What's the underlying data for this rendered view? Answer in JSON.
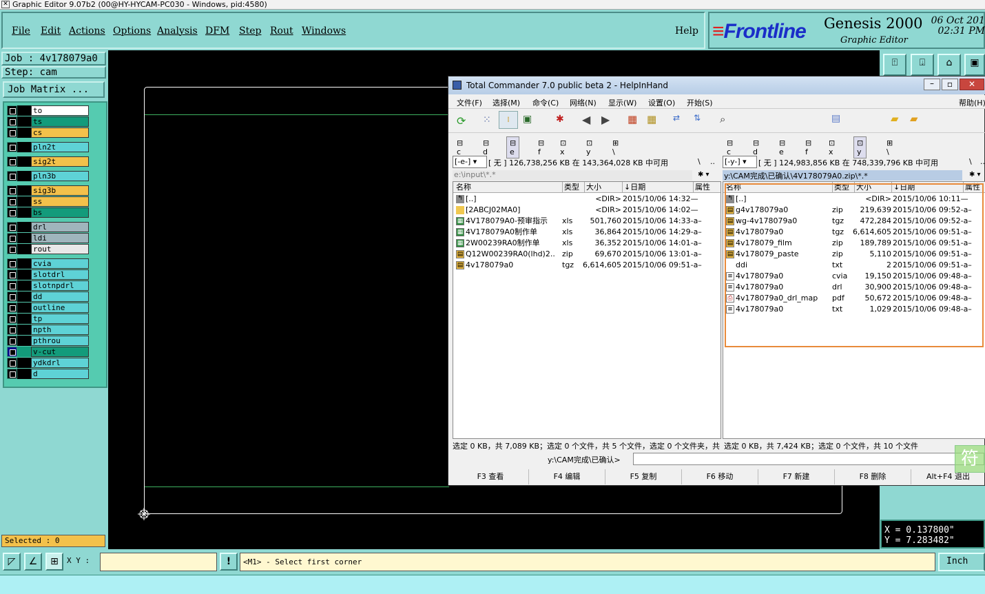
{
  "window": {
    "title": "Graphic Editor 9.07b2 (00@HY-HYCAM-PC030 - Windows, pid:4580)"
  },
  "menu": [
    "File",
    "Edit",
    "Actions",
    "Options",
    "Analysis",
    "DFM",
    "Step",
    "Rout",
    "Windows"
  ],
  "help_label": "Help",
  "brand": {
    "logo": "Frontline",
    "product": "Genesis 2000",
    "subtitle": "Graphic Editor",
    "date_line1": "06 Oct 201",
    "date_line2": "02:31 PM"
  },
  "job": {
    "job_label": "Job : 4v178079a0",
    "step_label": "Step: cam",
    "matrix_button": "Job Matrix ..."
  },
  "layers": [
    {
      "name": "to",
      "color": "#ffffff"
    },
    {
      "name": "ts",
      "color": "#139b7b"
    },
    {
      "name": "cs",
      "color": "#f3c14b"
    },
    {
      "name": "pln2t",
      "color": "#5ed2d6"
    },
    {
      "name": "sig2t",
      "color": "#f3c14b"
    },
    {
      "name": "pln3b",
      "color": "#5ed2d6"
    },
    {
      "name": "sig3b",
      "color": "#f3c14b"
    },
    {
      "name": "ss",
      "color": "#f3c14b"
    },
    {
      "name": "bs",
      "color": "#139b7b"
    },
    {
      "name": "drl",
      "color": "#9fb5bc"
    },
    {
      "name": "ldi",
      "color": "#9fb5bc"
    },
    {
      "name": "rout",
      "color": "#e8e8e8"
    },
    {
      "name": "cvia",
      "color": "#5ed2d6"
    },
    {
      "name": "slotdrl",
      "color": "#5ed2d6"
    },
    {
      "name": "slotnpdrl",
      "color": "#5ed2d6"
    },
    {
      "name": "dd",
      "color": "#5ed2d6"
    },
    {
      "name": "outline",
      "color": "#5ed2d6"
    },
    {
      "name": "tp",
      "color": "#5ed2d6"
    },
    {
      "name": "npth",
      "color": "#5ed2d6"
    },
    {
      "name": "pthrou",
      "color": "#5ed2d6"
    },
    {
      "name": "v-cut",
      "color": "#139b7b"
    },
    {
      "name": "ydkdrl",
      "color": "#5ed2d6"
    },
    {
      "name": "d",
      "color": "#5ed2d6"
    }
  ],
  "selected_label": "Selected : 0",
  "status": {
    "xy_label": "X Y :",
    "xy_value": "",
    "prompt": "<M1> - Select first corner",
    "unit": "Inch"
  },
  "coords": {
    "x": "X = 0.137800\"",
    "y": "Y = 7.283482\""
  },
  "tc": {
    "title": "Total Commander 7.0 public beta 2 - HelpInHand",
    "menu": [
      "文件(F)",
      "选择(M)",
      "命令(C)",
      "网络(N)",
      "显示(W)",
      "设置(O)",
      "开始(S)",
      "帮助(H)"
    ],
    "left_drives": [
      "c",
      "d",
      "e",
      "f",
      "x",
      "y",
      "\\"
    ],
    "right_drives": [
      "c",
      "d",
      "e",
      "f",
      "x",
      "y",
      "\\"
    ],
    "left_space": "[ 无 ]  126,738,256 KB 在 143,364,028 KB 中可用",
    "right_space": "[ 无 ]  124,983,856 KB 在 748,339,796 KB 中可用",
    "left_drive_sel": "[-e-]",
    "right_drive_sel": "[-y-]",
    "left_path": "e:\\input\\*.*",
    "right_path": "y:\\CAM完成\\已确认\\4V178079A0.zip\\*.*",
    "columns": {
      "name": "名称",
      "type": "类型",
      "size": "大小",
      "date": "↓日期",
      "attr": "属性"
    },
    "left_files": [
      {
        "name": "[..]",
        "type": "",
        "size": "<DIR>",
        "date": "2015/10/06 14:32—",
        "icon": "up"
      },
      {
        "name": "[2ABCJ02MA0]",
        "type": "",
        "size": "<DIR>",
        "date": "2015/10/06 14:02—",
        "icon": "folder"
      },
      {
        "name": "4V178079A0-预审指示",
        "type": "xls",
        "size": "501,760",
        "date": "2015/10/06 14:33-a–",
        "icon": "xls"
      },
      {
        "name": "4V178079A0制作单",
        "type": "xls",
        "size": "36,864",
        "date": "2015/10/06 14:29-a–",
        "icon": "xls"
      },
      {
        "name": "2W00239RA0制作单",
        "type": "xls",
        "size": "36,352",
        "date": "2015/10/06 14:01-a–",
        "icon": "xls"
      },
      {
        "name": "Q12W00239RA0(lhd)2..",
        "type": "zip",
        "size": "69,670",
        "date": "2015/10/06 13:01-a–",
        "icon": "zip"
      },
      {
        "name": "4v178079a0",
        "type": "tgz",
        "size": "6,614,605",
        "date": "2015/10/06 09:51-a–",
        "icon": "zip"
      }
    ],
    "right_files": [
      {
        "name": "[..]",
        "type": "",
        "size": "<DIR>",
        "date": "2015/10/06 10:11—",
        "icon": "up"
      },
      {
        "name": "g4v178079a0",
        "type": "zip",
        "size": "219,639",
        "date": "2015/10/06 09:52-a–",
        "icon": "zip"
      },
      {
        "name": "wg-4v178079a0",
        "type": "tgz",
        "size": "472,284",
        "date": "2015/10/06 09:52-a–",
        "icon": "zip"
      },
      {
        "name": "4v178079a0",
        "type": "tgz",
        "size": "6,614,605",
        "date": "2015/10/06 09:51-a–",
        "icon": "zip"
      },
      {
        "name": "4v178079_film",
        "type": "zip",
        "size": "189,789",
        "date": "2015/10/06 09:51-a–",
        "icon": "zip"
      },
      {
        "name": "4v178079_paste",
        "type": "zip",
        "size": "5,110",
        "date": "2015/10/06 09:51-a–",
        "icon": "zip"
      },
      {
        "name": "ddi",
        "type": "txt",
        "size": "2",
        "date": "2015/10/06 09:51-a–",
        "icon": "none"
      },
      {
        "name": "4v178079a0",
        "type": "cvia",
        "size": "19,150",
        "date": "2015/10/06 09:48-a–",
        "icon": "doc"
      },
      {
        "name": "4v178079a0",
        "type": "drl",
        "size": "30,900",
        "date": "2015/10/06 09:48-a–",
        "icon": "doc"
      },
      {
        "name": "4v178079a0_drl_map",
        "type": "pdf",
        "size": "50,672",
        "date": "2015/10/06 09:48-a–",
        "icon": "pdf"
      },
      {
        "name": "4v178079a0",
        "type": "txt",
        "size": "1,029",
        "date": "2015/10/06 09:48-a–",
        "icon": "doc"
      }
    ],
    "left_status": "选定 0 KB，共 7,089 KB；选定 0 个文件，共 5 个文件，选定 0 个文件夹，共 1 个文件夹",
    "right_status": "选定 0 KB，共 7,424 KB；选定 0 个文件，共 10 个文件",
    "cmd_path": "y:\\CAM完成\\已确认>",
    "fkeys": [
      "F3 查看",
      "F4 编辑",
      "F5 复制",
      "F6 移动",
      "F7 新建",
      "F8 删除",
      "Alt+F4 退出"
    ]
  },
  "ime_label": "符"
}
